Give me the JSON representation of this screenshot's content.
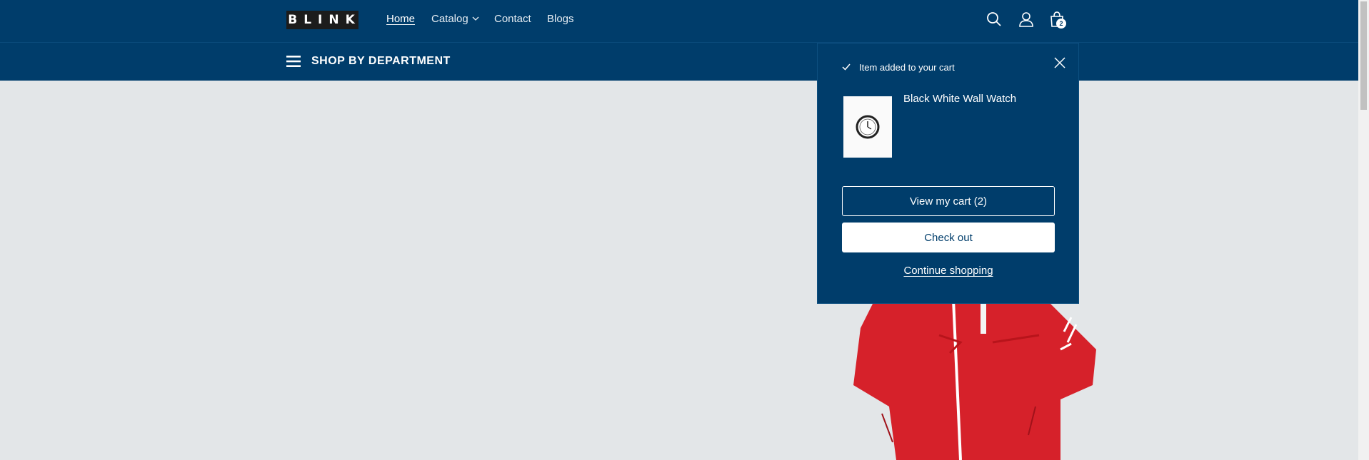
{
  "header": {
    "logo_text": "BLINK",
    "nav": [
      {
        "label": "Home",
        "active": true
      },
      {
        "label": "Catalog"
      },
      {
        "label": "Contact"
      },
      {
        "label": "Blogs"
      }
    ],
    "cart_count": "2"
  },
  "department_bar": {
    "label": "SHOP BY DEPARTMENT"
  },
  "cart_popup": {
    "status": "Item added to your cart",
    "product_name": "Black White Wall Watch",
    "view_cart_label": "View my cart (2)",
    "checkout_label": "Check out",
    "continue_label": "Continue shopping"
  },
  "colors": {
    "brand": "#003d6b",
    "page_bg": "#e3e6e8",
    "jacket": "#d6212a"
  }
}
